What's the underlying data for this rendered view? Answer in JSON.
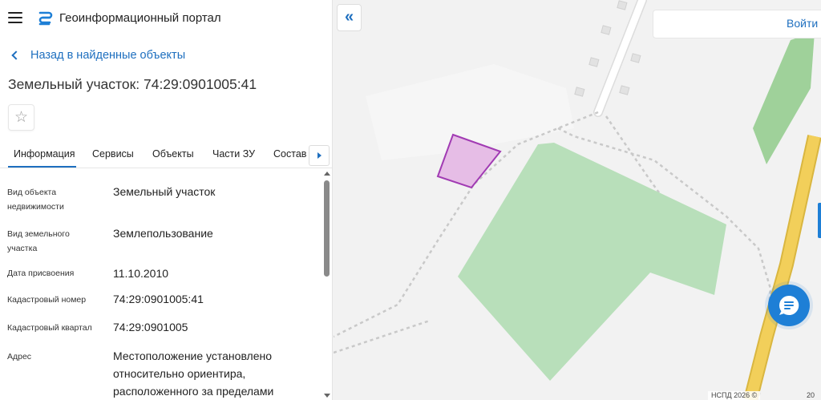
{
  "header": {
    "title": "Геоинформационный портал"
  },
  "nav": {
    "back_label": "Назад в найденные объекты"
  },
  "object": {
    "title": "Земельный участок: 74:29:0901005:41"
  },
  "tabs": [
    {
      "label": "Информация",
      "active": true
    },
    {
      "label": "Сервисы"
    },
    {
      "label": "Объекты"
    },
    {
      "label": "Части ЗУ"
    },
    {
      "label": "Состав"
    }
  ],
  "properties": [
    {
      "label": "Вид объекта недвижимости",
      "value": "Земельный участок"
    },
    {
      "label": "Вид земельного участка",
      "value": "Землепользование"
    },
    {
      "label": "Дата присвоения",
      "value": "11.10.2010"
    },
    {
      "label": "Кадастровый номер",
      "value": "74:29:0901005:41"
    },
    {
      "label": "Кадастровый квартал",
      "value": "74:29:0901005"
    },
    {
      "label": "Адрес",
      "value": "Местоположение установлено относительно ориентира, расположенного за пределами"
    }
  ],
  "map": {
    "login_label": "Войти",
    "attribution": "НСПД 2026 ©",
    "scale_label": "20"
  },
  "colors": {
    "accent": "#1e6fbf",
    "parcel_fill": "#e6bde6",
    "parcel_stroke": "#a13bb3",
    "greenery": "#b8dfba",
    "road": "#f2cf5a"
  },
  "icons": {
    "menu": "hamburger-icon",
    "favorite": "star-icon",
    "chat": "chat-icon",
    "collapse": "double-chevron-left-icon"
  }
}
